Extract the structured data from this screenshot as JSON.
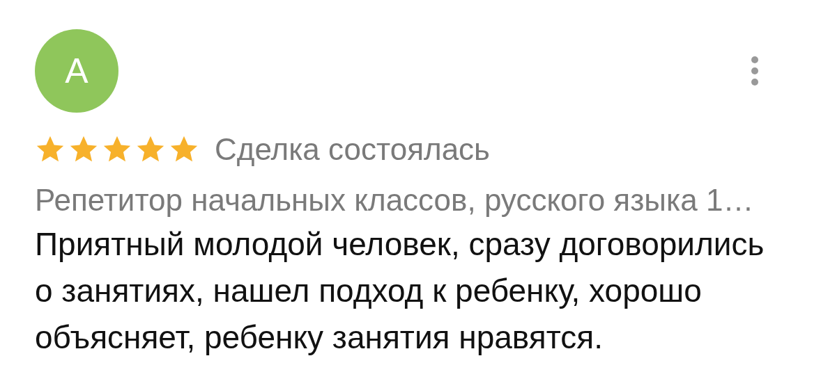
{
  "review": {
    "avatar_letter": "A",
    "stars": 5,
    "status": "Сделка состоялась",
    "subject": "Репетитор начальных классов, русского языка 1…",
    "text": "Приятный молодой человек, сразу договорились о занятиях, нашел подход к ребенку, хорошо объясняет, ребенку занятия нравятся."
  }
}
